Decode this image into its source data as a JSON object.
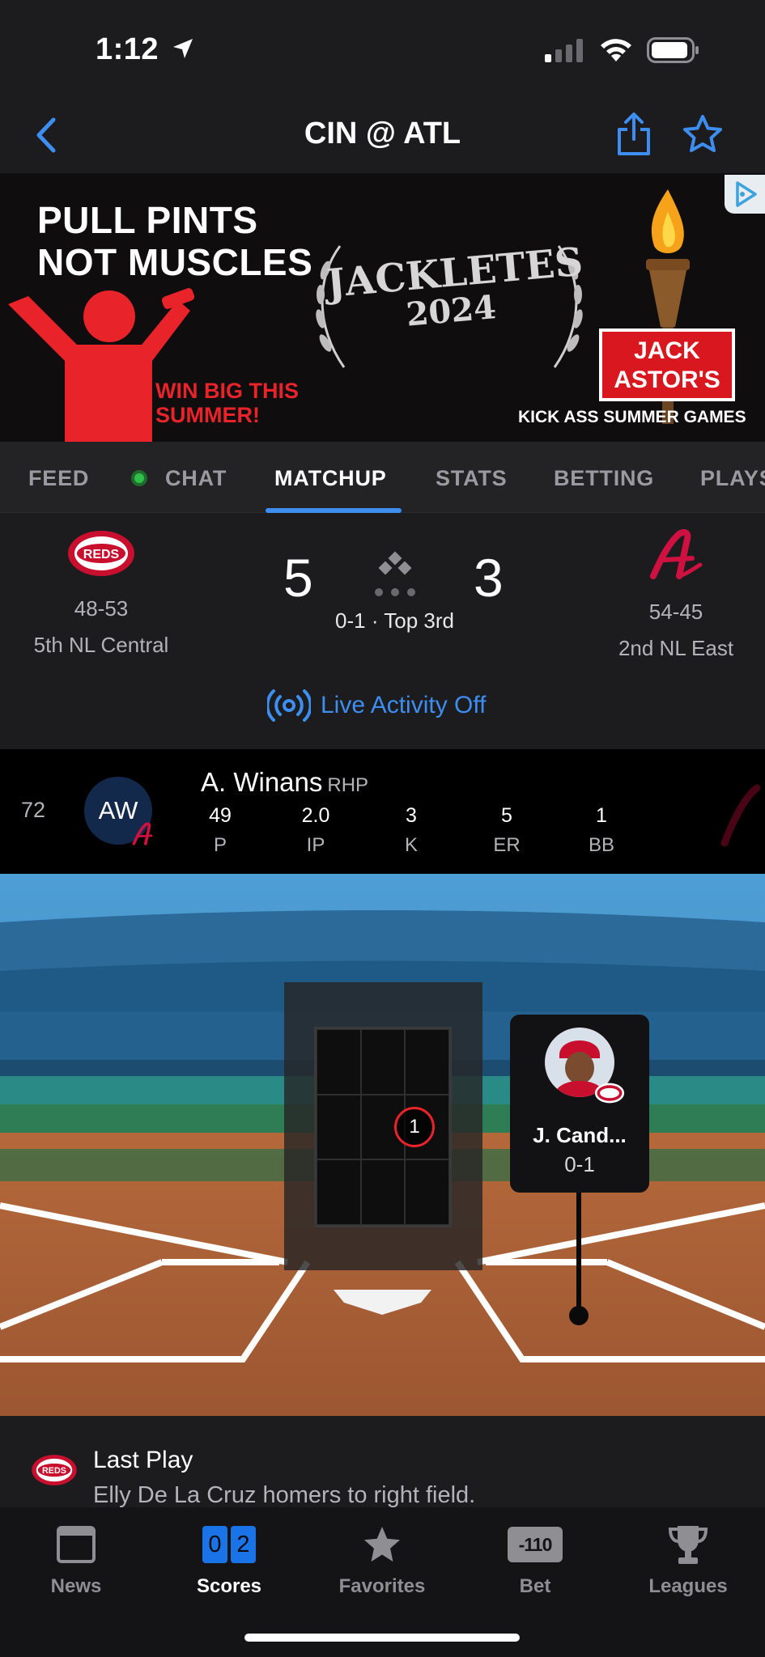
{
  "status_bar": {
    "time": "1:12"
  },
  "nav": {
    "title": "CIN @ ATL"
  },
  "ad": {
    "headline_line1": "PULL PINTS",
    "headline_line2": "NOT MUSCLES",
    "win_line1": "WIN BIG THIS",
    "win_line2": "SUMMER!",
    "event_line1": "JACKLETES",
    "event_line2": "2024",
    "brand_line1": "JACK",
    "brand_line2": "ASTOR'S",
    "tagline": "KICK ASS SUMMER GAMES"
  },
  "tabs": [
    {
      "label": "FEED"
    },
    {
      "label": "CHAT"
    },
    {
      "label": "MATCHUP"
    },
    {
      "label": "STATS"
    },
    {
      "label": "BETTING"
    },
    {
      "label": "PLAYS"
    }
  ],
  "scoreboard": {
    "away": {
      "logo_text": "REDS",
      "record": "48-53",
      "standing": "5th NL Central",
      "score": "5"
    },
    "home": {
      "logo_text": "A",
      "record": "54-45",
      "standing": "2nd NL East",
      "score": "3"
    },
    "status": "0-1 · Top 3rd",
    "live_activity": "Live Activity Off"
  },
  "pitcher": {
    "pitch_count": "72",
    "initials": "AW",
    "name": "A. Winans",
    "position": "RHP",
    "stats": [
      {
        "value": "49",
        "label": "P"
      },
      {
        "value": "2.0",
        "label": "IP"
      },
      {
        "value": "3",
        "label": "K"
      },
      {
        "value": "5",
        "label": "ER"
      },
      {
        "value": "1",
        "label": "BB"
      }
    ]
  },
  "field": {
    "pitch_marker": "1",
    "batter": {
      "name": "J. Cand...",
      "count": "0-1"
    }
  },
  "last_play": {
    "title": "Last Play",
    "text": "Elly De La Cruz homers to right field."
  },
  "tabbar": {
    "items": [
      {
        "label": "News"
      },
      {
        "label": "Scores",
        "digits": [
          "0",
          "2"
        ]
      },
      {
        "label": "Favorites"
      },
      {
        "label": "Bet",
        "odds": "-110"
      },
      {
        "label": "Leagues"
      }
    ]
  },
  "colors": {
    "accent_blue": "#3d8ef0",
    "reds_red": "#c8102e",
    "braves_red": "#ce1141",
    "braves_navy": "#13294b",
    "live_green": "#2fbf4b"
  }
}
